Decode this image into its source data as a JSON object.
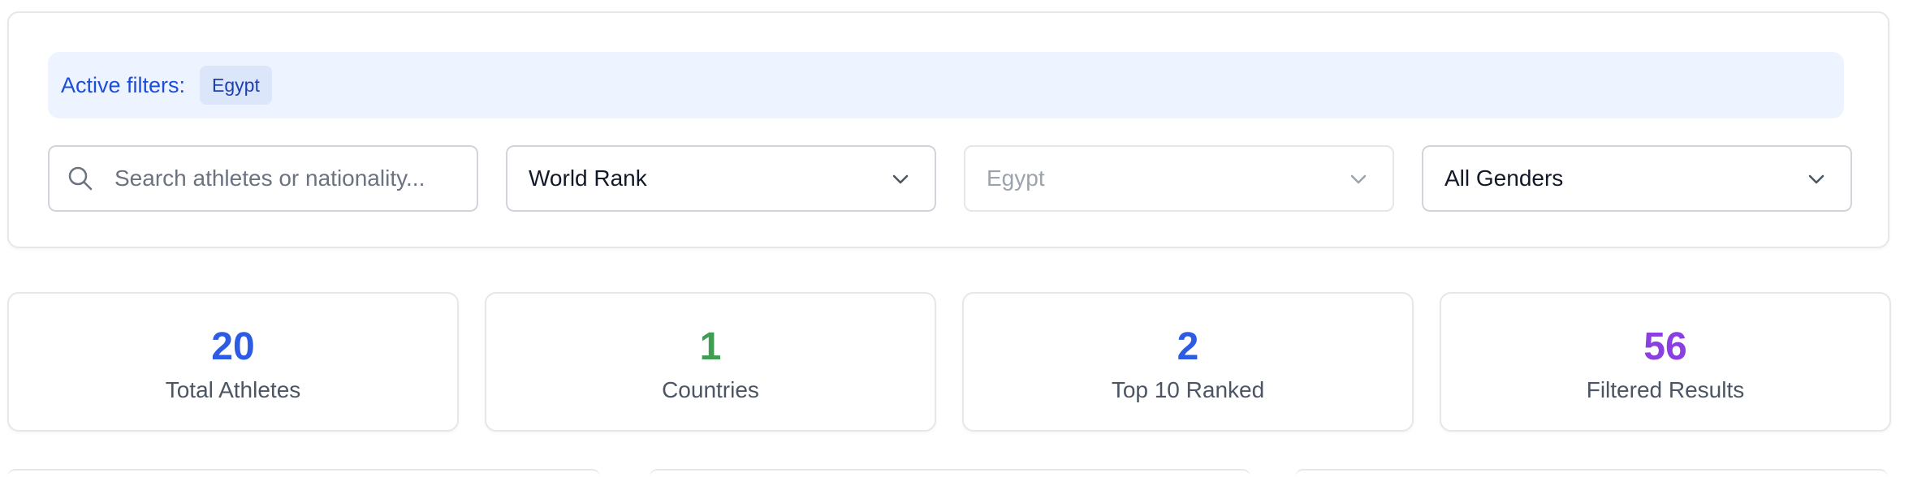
{
  "filters": {
    "active_label": "Active filters:",
    "active_chips": [
      "Egypt"
    ],
    "search": {
      "placeholder": "Search athletes or nationality..."
    },
    "sort": {
      "value": "World Rank"
    },
    "country": {
      "value": "Egypt"
    },
    "gender": {
      "value": "All Genders"
    }
  },
  "stats": [
    {
      "value": "20",
      "label": "Total Athletes",
      "color": "#2d5be3"
    },
    {
      "value": "1",
      "label": "Countries",
      "color": "#3f9e52"
    },
    {
      "value": "2",
      "label": "Top 10 Ranked",
      "color": "#2d5be3"
    },
    {
      "value": "56",
      "label": "Filtered Results",
      "color": "#8a3fe0"
    }
  ],
  "icons": {
    "search": "search-icon",
    "dropdown": "chevron-down-icon"
  }
}
